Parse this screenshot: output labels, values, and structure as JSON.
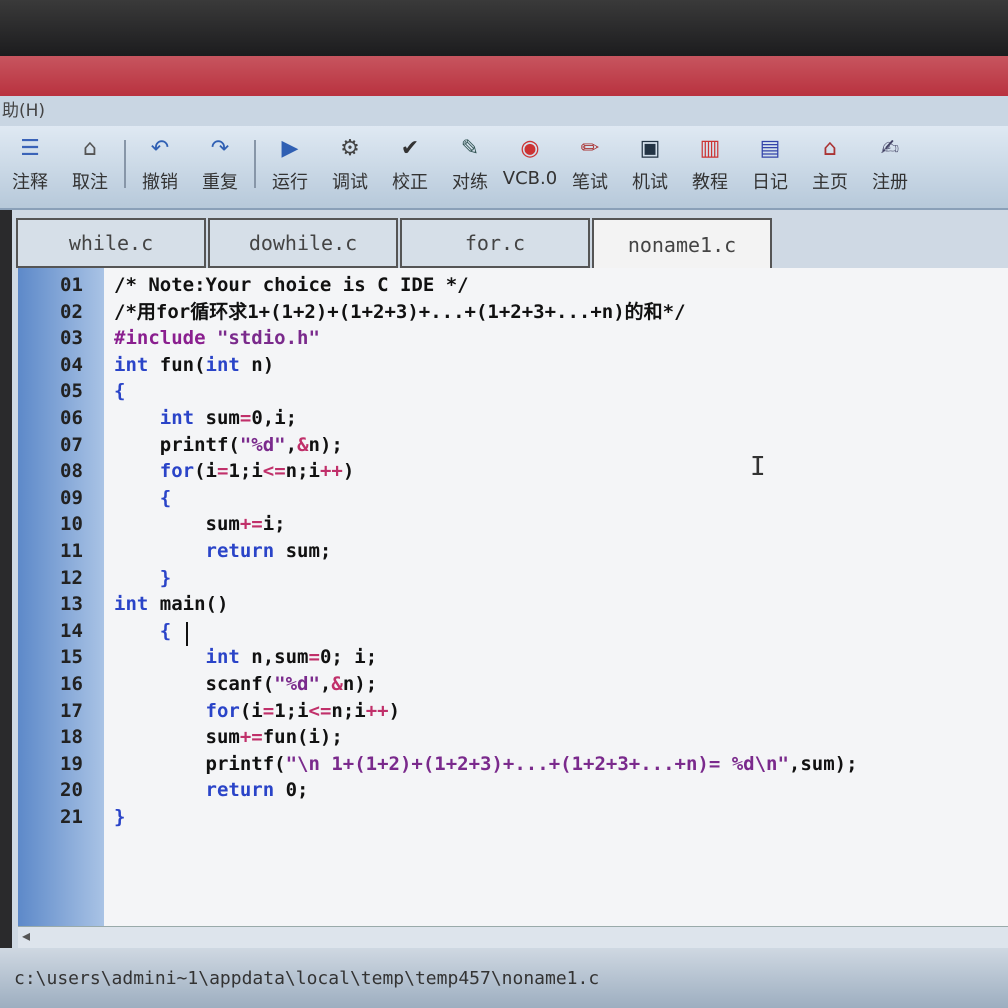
{
  "menubar": {
    "help_label": "助(H)"
  },
  "toolbar": [
    {
      "label": "注释",
      "icon": "comment-icon",
      "glyph": "☰"
    },
    {
      "label": "取注",
      "icon": "uncomment-icon",
      "glyph": "⌂"
    },
    {
      "label": "撤销",
      "icon": "undo-icon",
      "glyph": "↶"
    },
    {
      "label": "重复",
      "icon": "redo-icon",
      "glyph": "↷"
    },
    {
      "label": "运行",
      "icon": "run-icon",
      "glyph": "▶"
    },
    {
      "label": "调试",
      "icon": "debug-icon",
      "glyph": "⚙"
    },
    {
      "label": "校正",
      "icon": "check-icon",
      "glyph": "✔"
    },
    {
      "label": "对练",
      "icon": "practice-icon",
      "glyph": "✎"
    },
    {
      "label": "VCB.0",
      "icon": "vcb-icon",
      "glyph": "◉"
    },
    {
      "label": "笔试",
      "icon": "pen-test-icon",
      "glyph": "✏"
    },
    {
      "label": "机试",
      "icon": "machine-test-icon",
      "glyph": "▣"
    },
    {
      "label": "教程",
      "icon": "tutorial-icon",
      "glyph": "▥"
    },
    {
      "label": "日记",
      "icon": "diary-icon",
      "glyph": "▤"
    },
    {
      "label": "主页",
      "icon": "home-icon",
      "glyph": "⌂"
    },
    {
      "label": "注册",
      "icon": "register-icon",
      "glyph": "✍"
    }
  ],
  "tabs": [
    "while.c",
    "dowhile.c",
    "for.c",
    "noname1.c"
  ],
  "active_tab": "noname1.c",
  "code": {
    "lines": [
      "/* Note:Your choice is C IDE */",
      "/*用for循环求1+(1+2)+(1+2+3)+...+(1+2+3+...+n)的和*/",
      "#include \"stdio.h\"",
      "int fun(int n)",
      "{",
      "    int sum=0,i;",
      "    printf(\"%d\",&n);",
      "    for(i=1;i<=n;i++)",
      "    {",
      "        sum+=i;",
      "        return sum;",
      "    }",
      "int main()",
      "    {",
      "        int n,sum=0; i;",
      "        scanf(\"%d\",&n);",
      "        for(i=1;i<=n;i++)",
      "        sum+=fun(i);",
      "        printf(\"\\n 1+(1+2)+(1+2+3)+...+(1+2+3+...+n)= %d\\n\",sum);",
      "        return 0;",
      "}"
    ],
    "line_numbers": [
      "01",
      "02",
      "03",
      "04",
      "05",
      "06",
      "07",
      "08",
      "09",
      "10",
      "11",
      "12",
      "13",
      "14",
      "15",
      "16",
      "17",
      "18",
      "19",
      "20",
      "21"
    ]
  },
  "status": {
    "path": "c:\\users\\admini~1\\appdata\\local\\temp\\temp457\\noname1.c"
  }
}
